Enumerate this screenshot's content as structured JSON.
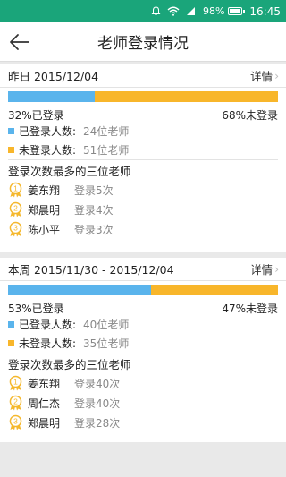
{
  "status": {
    "battery": "98%",
    "time": "16:45"
  },
  "header": {
    "title": "老师登录情况"
  },
  "colors": {
    "logged": "#5ab4ec",
    "not_logged": "#f8b62b",
    "medal": "#f5b82d"
  },
  "cards": [
    {
      "period": "昨日 2015/12/04",
      "detail": "详情",
      "logged_fraction": 0.32,
      "logged_pct_text": "32%已登录",
      "not_logged_pct_text": "68%未登录",
      "legend": [
        {
          "label": "已登录人数:",
          "value": "24位老师"
        },
        {
          "label": "未登录人数:",
          "value": "51位老师"
        }
      ],
      "top_title": "登录次数最多的三位老师",
      "top": [
        {
          "rank": "1",
          "name": "姜东翔",
          "count": "登录5次"
        },
        {
          "rank": "2",
          "name": "郑晨明",
          "count": "登录4次"
        },
        {
          "rank": "3",
          "name": "陈小平",
          "count": "登录3次"
        }
      ]
    },
    {
      "period": "本周 2015/11/30 - 2015/12/04",
      "detail": "详情",
      "logged_fraction": 0.53,
      "logged_pct_text": "53%已登录",
      "not_logged_pct_text": "47%未登录",
      "legend": [
        {
          "label": "已登录人数:",
          "value": "40位老师"
        },
        {
          "label": "未登录人数:",
          "value": "35位老师"
        }
      ],
      "top_title": "登录次数最多的三位老师",
      "top": [
        {
          "rank": "1",
          "name": "姜东翔",
          "count": "登录40次"
        },
        {
          "rank": "2",
          "name": "周仁杰",
          "count": "登录40次"
        },
        {
          "rank": "3",
          "name": "郑晨明",
          "count": "登录28次"
        }
      ]
    }
  ]
}
